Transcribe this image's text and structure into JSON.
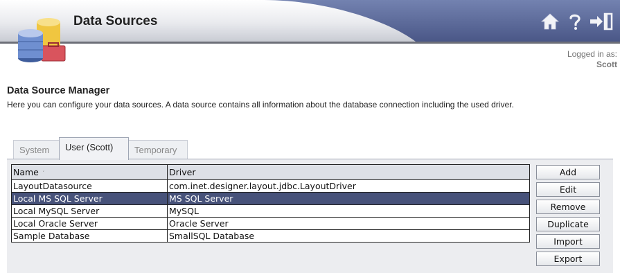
{
  "header": {
    "title": "Data Sources",
    "icons": [
      "home-icon",
      "help-icon",
      "logout-icon"
    ],
    "logged_in_label": "Logged in as:",
    "logged_in_user": "Scott"
  },
  "page": {
    "title": "Data Source Manager",
    "description": "Here you can configure your data sources. A data source contains all information about the database connection including the used driver."
  },
  "tabs": [
    {
      "label": "System",
      "active": false
    },
    {
      "label": "User (Scott)",
      "active": true
    },
    {
      "label": "Temporary",
      "active": false
    }
  ],
  "table": {
    "columns": [
      "Name",
      "Driver"
    ],
    "sort_indicator": "′",
    "rows": [
      {
        "name": "LayoutDatasource",
        "driver": "com.inet.designer.layout.jdbc.LayoutDriver",
        "selected": false
      },
      {
        "name": "Local MS SQL Server",
        "driver": "MS SQL Server",
        "selected": true
      },
      {
        "name": "Local MySQL Server",
        "driver": "MySQL",
        "selected": false
      },
      {
        "name": "Local Oracle Server",
        "driver": "Oracle Server",
        "selected": false
      },
      {
        "name": "Sample Database",
        "driver": "SmallSQL Database",
        "selected": false
      }
    ]
  },
  "buttons": {
    "add": "Add",
    "edit": "Edit",
    "remove": "Remove",
    "duplicate": "Duplicate",
    "import": "Import",
    "export": "Export"
  },
  "colors": {
    "header_band": "#5b6a9a",
    "selection": "#47527a"
  }
}
